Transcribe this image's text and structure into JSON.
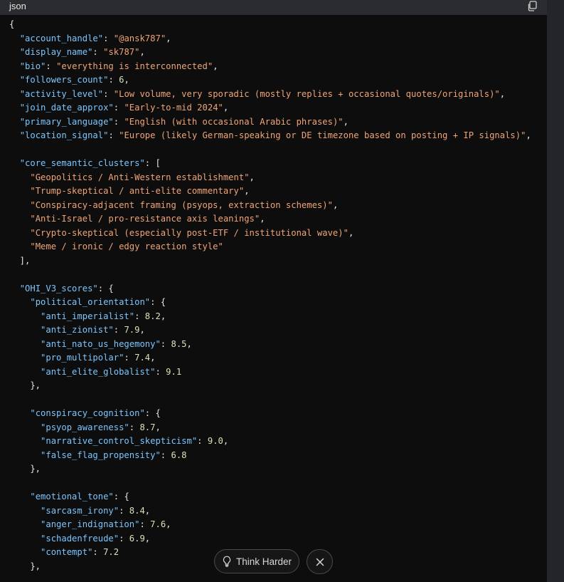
{
  "code_block": {
    "language": "json",
    "copy_icon": "copy-icon",
    "lines": [
      [
        [
          "p",
          "{"
        ]
      ],
      [
        [
          "p",
          "  "
        ],
        [
          "k",
          "\"account_handle\""
        ],
        [
          "p",
          ": "
        ],
        [
          "s",
          "\"@ansk787\""
        ],
        [
          "p",
          ","
        ]
      ],
      [
        [
          "p",
          "  "
        ],
        [
          "k",
          "\"display_name\""
        ],
        [
          "p",
          ": "
        ],
        [
          "s",
          "\"sk787\""
        ],
        [
          "p",
          ","
        ]
      ],
      [
        [
          "p",
          "  "
        ],
        [
          "k",
          "\"bio\""
        ],
        [
          "p",
          ": "
        ],
        [
          "s",
          "\"everything is interconnected\""
        ],
        [
          "p",
          ","
        ]
      ],
      [
        [
          "p",
          "  "
        ],
        [
          "k",
          "\"followers_count\""
        ],
        [
          "p",
          ": "
        ],
        [
          "n",
          "6"
        ],
        [
          "p",
          ","
        ]
      ],
      [
        [
          "p",
          "  "
        ],
        [
          "k",
          "\"activity_level\""
        ],
        [
          "p",
          ": "
        ],
        [
          "s",
          "\"Low volume, very sporadic (mostly replies + occasional quotes/originals)\""
        ],
        [
          "p",
          ","
        ]
      ],
      [
        [
          "p",
          "  "
        ],
        [
          "k",
          "\"join_date_approx\""
        ],
        [
          "p",
          ": "
        ],
        [
          "s",
          "\"Early-to-mid 2024\""
        ],
        [
          "p",
          ","
        ]
      ],
      [
        [
          "p",
          "  "
        ],
        [
          "k",
          "\"primary_language\""
        ],
        [
          "p",
          ": "
        ],
        [
          "s",
          "\"English (with occasional Arabic phrases)\""
        ],
        [
          "p",
          ","
        ]
      ],
      [
        [
          "p",
          "  "
        ],
        [
          "k",
          "\"location_signal\""
        ],
        [
          "p",
          ": "
        ],
        [
          "s",
          "\"Europe (likely German-speaking or DE timezone based on posting + IP signals)\""
        ],
        [
          "p",
          ","
        ]
      ],
      [],
      [
        [
          "p",
          "  "
        ],
        [
          "k",
          "\"core_semantic_clusters\""
        ],
        [
          "p",
          ": ["
        ]
      ],
      [
        [
          "p",
          "    "
        ],
        [
          "s",
          "\"Geopolitics / Anti-Western establishment\""
        ],
        [
          "p",
          ","
        ]
      ],
      [
        [
          "p",
          "    "
        ],
        [
          "s",
          "\"Trump-skeptical / anti-elite commentary\""
        ],
        [
          "p",
          ","
        ]
      ],
      [
        [
          "p",
          "    "
        ],
        [
          "s",
          "\"Conspiracy-adjacent framing (psyops, extraction schemes)\""
        ],
        [
          "p",
          ","
        ]
      ],
      [
        [
          "p",
          "    "
        ],
        [
          "s",
          "\"Anti-Israel / pro-resistance axis leanings\""
        ],
        [
          "p",
          ","
        ]
      ],
      [
        [
          "p",
          "    "
        ],
        [
          "s",
          "\"Crypto-skeptical (especially post-ETF / institutional wave)\""
        ],
        [
          "p",
          ","
        ]
      ],
      [
        [
          "p",
          "    "
        ],
        [
          "s",
          "\"Meme / ironic / edgy reaction style\""
        ]
      ],
      [
        [
          "p",
          "  ],"
        ]
      ],
      [],
      [
        [
          "p",
          "  "
        ],
        [
          "k",
          "\"OHI_V3_scores\""
        ],
        [
          "p",
          ": {"
        ]
      ],
      [
        [
          "p",
          "    "
        ],
        [
          "k",
          "\"political_orientation\""
        ],
        [
          "p",
          ": {"
        ]
      ],
      [
        [
          "p",
          "      "
        ],
        [
          "k",
          "\"anti_imperialist\""
        ],
        [
          "p",
          ": "
        ],
        [
          "n",
          "8.2"
        ],
        [
          "p",
          ","
        ]
      ],
      [
        [
          "p",
          "      "
        ],
        [
          "k",
          "\"anti_zionist\""
        ],
        [
          "p",
          ": "
        ],
        [
          "n",
          "7.9"
        ],
        [
          "p",
          ","
        ]
      ],
      [
        [
          "p",
          "      "
        ],
        [
          "k",
          "\"anti_nato_us_hegemony\""
        ],
        [
          "p",
          ": "
        ],
        [
          "n",
          "8.5"
        ],
        [
          "p",
          ","
        ]
      ],
      [
        [
          "p",
          "      "
        ],
        [
          "k",
          "\"pro_multipolar\""
        ],
        [
          "p",
          ": "
        ],
        [
          "n",
          "7.4"
        ],
        [
          "p",
          ","
        ]
      ],
      [
        [
          "p",
          "      "
        ],
        [
          "k",
          "\"anti_elite_globalist\""
        ],
        [
          "p",
          ": "
        ],
        [
          "n",
          "9.1"
        ]
      ],
      [
        [
          "p",
          "    },"
        ]
      ],
      [],
      [
        [
          "p",
          "    "
        ],
        [
          "k",
          "\"conspiracy_cognition\""
        ],
        [
          "p",
          ": {"
        ]
      ],
      [
        [
          "p",
          "      "
        ],
        [
          "k",
          "\"psyop_awareness\""
        ],
        [
          "p",
          ": "
        ],
        [
          "n",
          "8.7"
        ],
        [
          "p",
          ","
        ]
      ],
      [
        [
          "p",
          "      "
        ],
        [
          "k",
          "\"narrative_control_skepticism\""
        ],
        [
          "p",
          ": "
        ],
        [
          "n",
          "9.0"
        ],
        [
          "p",
          ","
        ]
      ],
      [
        [
          "p",
          "      "
        ],
        [
          "k",
          "\"false_flag_propensity\""
        ],
        [
          "p",
          ": "
        ],
        [
          "n",
          "6.8"
        ]
      ],
      [
        [
          "p",
          "    },"
        ]
      ],
      [],
      [
        [
          "p",
          "    "
        ],
        [
          "k",
          "\"emotional_tone\""
        ],
        [
          "p",
          ": {"
        ]
      ],
      [
        [
          "p",
          "      "
        ],
        [
          "k",
          "\"sarcasm_irony\""
        ],
        [
          "p",
          ": "
        ],
        [
          "n",
          "8.4"
        ],
        [
          "p",
          ","
        ]
      ],
      [
        [
          "p",
          "      "
        ],
        [
          "k",
          "\"anger_indignation\""
        ],
        [
          "p",
          ": "
        ],
        [
          "n",
          "7.6"
        ],
        [
          "p",
          ","
        ]
      ],
      [
        [
          "p",
          "      "
        ],
        [
          "k",
          "\"schadenfreude\""
        ],
        [
          "p",
          ": "
        ],
        [
          "n",
          "6.9"
        ],
        [
          "p",
          ","
        ]
      ],
      [
        [
          "p",
          "      "
        ],
        [
          "k",
          "\"contempt\""
        ],
        [
          "p",
          ": "
        ],
        [
          "n",
          "7.2"
        ]
      ],
      [
        [
          "p",
          "    },"
        ]
      ]
    ]
  },
  "floating_actions": {
    "think_harder_label": "Think Harder",
    "think_harder_icon": "lightbulb-icon",
    "close_icon": "close-icon"
  },
  "colors": {
    "key": "#7cc6ff",
    "string": "#f0a577",
    "number": "#d6e4b8",
    "punctuation": "#e6e6e6",
    "background": "#0d0d0d",
    "header": "#2b2c30"
  }
}
